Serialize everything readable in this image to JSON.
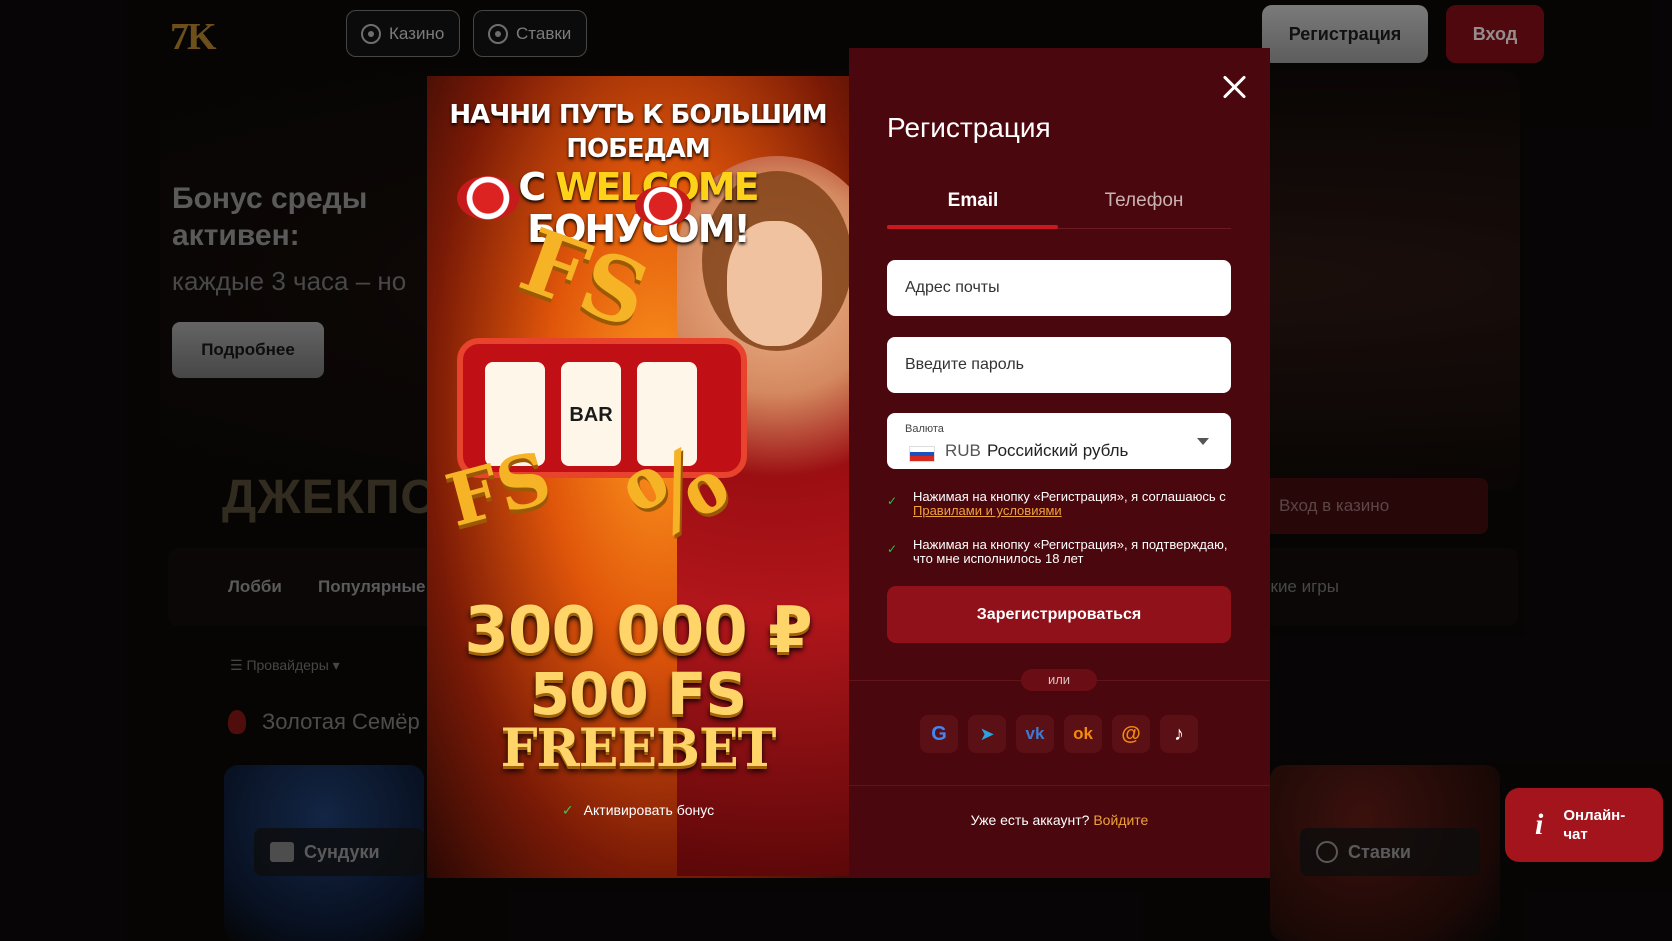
{
  "header": {
    "logo_text": "7K",
    "tabs": [
      {
        "label": "Казино",
        "icon": "casino-chip-icon"
      },
      {
        "label": "Ставки",
        "icon": "soccer-ball-icon"
      }
    ],
    "register_label": "Регистрация",
    "login_label": "Вход"
  },
  "hero": {
    "title": "Бонус среды активен:",
    "subtitle": "каждые 3 часа – но",
    "button": "Подробнее"
  },
  "jackpot_label": "ДЖЕКПО",
  "casino_login_label": "Вход в казино",
  "nav": {
    "items": [
      "Лобби",
      "Популярные",
      "ские игры"
    ]
  },
  "providers_label": "Провайдеры",
  "section_title": "Золотая Семёр",
  "bottom_chips": [
    {
      "label": "Сундуки",
      "icon": "chest-icon"
    },
    {
      "label": "Ставки",
      "icon": "soccer-ball-icon"
    }
  ],
  "chat": {
    "icon": "info-icon",
    "label": "Онлайн-чат"
  },
  "promo": {
    "headline_line1": "НАЧНИ ПУТЬ К БОЛЬШИМ ПОБЕДАМ",
    "headline_prefix": "С",
    "headline_highlight": "WELCOME",
    "headline_suffix": "БОНУСОМ!",
    "amount": "300 000 ₽",
    "free_spins": "500 FS",
    "freebet": "FREEBET",
    "slot_symbol": "BAR",
    "fs_decor": "FS",
    "percent_decor": "%",
    "activate_label": "Активировать бонус"
  },
  "registration": {
    "title": "Регистрация",
    "tabs": [
      {
        "label": "Email",
        "active": true
      },
      {
        "label": "Телефон",
        "active": false
      }
    ],
    "email_placeholder": "Адрес почты",
    "password_placeholder": "Введите пароль",
    "currency_label": "Валюта",
    "currency_code": "RUB",
    "currency_name": "Российский рубль",
    "consent_terms_text": "Нажимая на кнопку «Регистрация», я соглашаюсь с",
    "consent_terms_link": "Правилами и условиями",
    "consent_age_text": "Нажимая на кнопку «Регистрация», я подтверждаю, что мне исполнилось 18 лет",
    "submit_label": "Зарегистрироваться",
    "or_label": "или",
    "social": [
      {
        "name": "google-icon",
        "glyph": "G",
        "color": "#4285f4"
      },
      {
        "name": "telegram-icon",
        "glyph": "➤",
        "color": "#2aa3e0"
      },
      {
        "name": "vk-icon",
        "glyph": "vk",
        "color": "#3b7bd4"
      },
      {
        "name": "odnoklassniki-icon",
        "glyph": "ok",
        "color": "#f28a0f"
      },
      {
        "name": "mail-at-icon",
        "glyph": "@",
        "color": "#f28a0f"
      },
      {
        "name": "tiktok-icon",
        "glyph": "♪",
        "color": "#ffffff"
      }
    ],
    "have_account_text": "Уже есть аккаунт?",
    "login_link": "Войдите"
  }
}
